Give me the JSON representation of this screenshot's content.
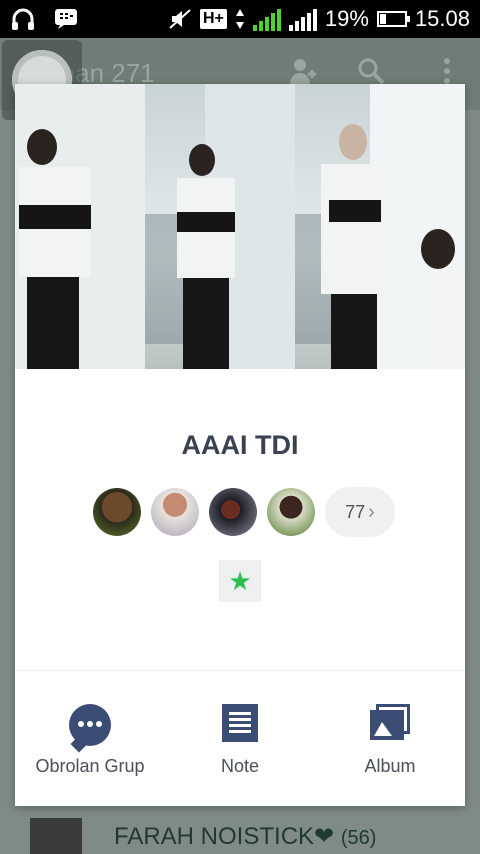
{
  "status_bar": {
    "battery_percent": "19%",
    "time": "15.08",
    "network_type": "H+",
    "sim1": "1",
    "sim2": "2"
  },
  "app_header": {
    "title": "Teman 271"
  },
  "background_list": {
    "item_name": "FARAH NOISTICK❤",
    "item_count": "(56)"
  },
  "group_card": {
    "name": "AAAI TDI",
    "member_more_count": "77",
    "member_more_chevron": "›",
    "favorite_icon": "★",
    "actions": [
      {
        "label": "Obrolan Grup",
        "icon": "chat-bubble-icon"
      },
      {
        "label": "Note",
        "icon": "note-icon"
      },
      {
        "label": "Album",
        "icon": "album-icon"
      }
    ]
  },
  "colors": {
    "accent": "#3c4d75",
    "favorite": "#2bbf4f",
    "title_text": "#3a4150"
  }
}
